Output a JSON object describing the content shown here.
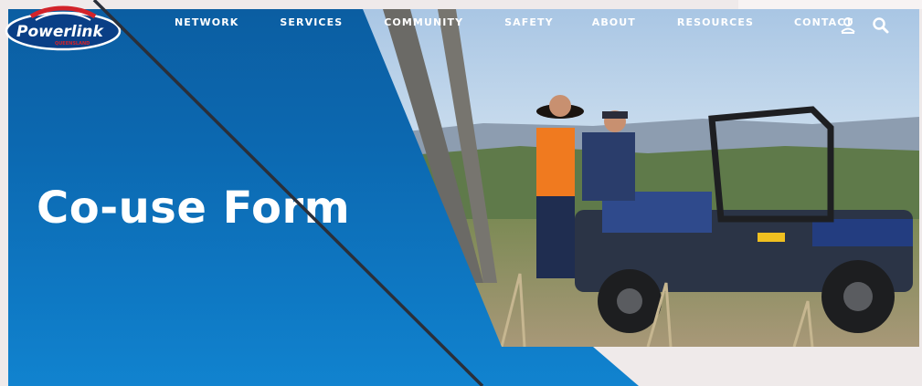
{
  "brand": {
    "logo_text": "Powerlink",
    "logo_subtext": "QUEENSLAND"
  },
  "nav": {
    "items": [
      {
        "label": "NETWORK"
      },
      {
        "label": "SERVICES"
      },
      {
        "label": "COMMUNITY"
      },
      {
        "label": "SAFETY"
      },
      {
        "label": "ABOUT"
      },
      {
        "label": "RESOURCES"
      },
      {
        "label": "CONTACT"
      }
    ],
    "icons": [
      "user-icon",
      "search-icon"
    ]
  },
  "hero": {
    "title": "Co-use Form"
  },
  "colors": {
    "blue_top": "#0b5ea2",
    "blue_bottom": "#1183cf",
    "page_bg": "#efeaea",
    "logo_red": "#d2232a"
  }
}
